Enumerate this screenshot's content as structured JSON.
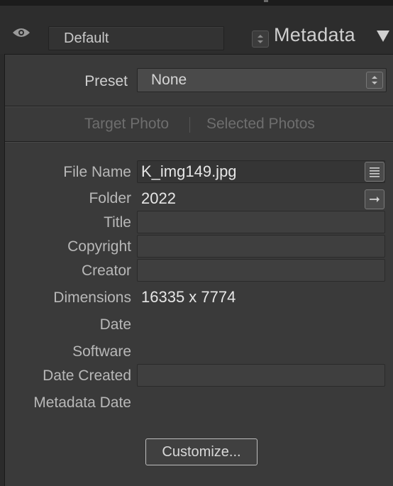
{
  "header": {
    "preset_select_value": "Default",
    "panel_title": "Metadata"
  },
  "preset": {
    "label": "Preset",
    "value": "None"
  },
  "target_toggle": {
    "target_photo": "Target Photo",
    "selected_photos": "Selected Photos"
  },
  "fields": {
    "file_name": {
      "label": "File Name",
      "value": "K_img149.jpg"
    },
    "folder": {
      "label": "Folder",
      "value": "2022"
    },
    "title": {
      "label": "Title",
      "value": ""
    },
    "copyright": {
      "label": "Copyright",
      "value": ""
    },
    "creator": {
      "label": "Creator",
      "value": ""
    },
    "dimensions": {
      "label": "Dimensions",
      "value": "16335 x 7774"
    },
    "date": {
      "label": "Date",
      "value": ""
    },
    "software": {
      "label": "Software",
      "value": ""
    },
    "date_created": {
      "label": "Date Created",
      "value": ""
    },
    "metadata_date": {
      "label": "Metadata Date",
      "value": ""
    }
  },
  "customize_button": "Customize...",
  "icons": {
    "visibility": "eye-icon",
    "spinner": "up-down-arrows-icon",
    "collapse": "triangle-down-icon",
    "rename": "list-icon",
    "go_to_folder": "arrow-right-icon"
  },
  "colors": {
    "background": "#2b2b2b",
    "panel": "#3a3a3a",
    "text": "#cfcfcf",
    "disabled_text": "#6e6e6e"
  }
}
